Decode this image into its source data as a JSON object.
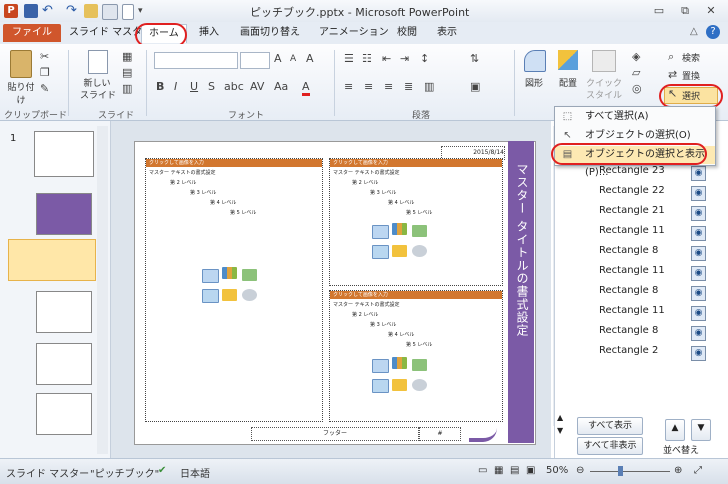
{
  "window": {
    "title": "ピッチブック.pptx - Microsoft PowerPoint"
  },
  "tabs": [
    {
      "label": "ファイル"
    },
    {
      "label": "スライド マスター"
    },
    {
      "label": "ホーム"
    },
    {
      "label": "挿入"
    },
    {
      "label": "画面切り替え"
    },
    {
      "label": "アニメーション"
    },
    {
      "label": "校閲"
    },
    {
      "label": "表示"
    }
  ],
  "ribbon": {
    "paste_label": "貼り付け",
    "new_slide_label": "新しい",
    "new_slide_label2": "スライド",
    "clipboard_group": "クリップボード",
    "slides_group": "スライド",
    "font_group": "フォント",
    "paragraph_group": "段落",
    "shape_label": "図形",
    "arrange_label": "配置",
    "quick_style_label": "クイック",
    "quick_style_label2": "スタイル",
    "find_label": "検索",
    "replace_label": "置換",
    "select_label": "選択"
  },
  "dropdown": {
    "items": [
      {
        "label": "すべて選択(A)"
      },
      {
        "label": "オブジェクトの選択(O)"
      },
      {
        "label": "オブジェクトの選択と表示(P)..."
      }
    ]
  },
  "slide": {
    "date": "2015/8/14",
    "placeholder_head": "クリックして画像を入力",
    "level1": "マスター テキストの書式設定",
    "level2": "第 2 レベル",
    "level3": "第 3 レベル",
    "level4": "第 4 レベル",
    "level5": "第 5 レベル",
    "footer": "フッター",
    "page_marker": "#",
    "vertical_title": "マスター タイトルの書式設定"
  },
  "thumbnails": {
    "first_number": "1"
  },
  "selection_pane": {
    "shapes": [
      {
        "name": "Rectangle 23"
      },
      {
        "name": "Rectangle 22"
      },
      {
        "name": "Rectangle 21"
      },
      {
        "name": "Rectangle 11"
      },
      {
        "name": "Rectangle 8"
      },
      {
        "name": "Rectangle 11"
      },
      {
        "name": "Rectangle 8"
      },
      {
        "name": "Rectangle 11"
      },
      {
        "name": "Rectangle 8"
      },
      {
        "name": "Rectangle 2"
      }
    ],
    "show_all": "すべて表示",
    "hide_all": "すべて非表示",
    "reorder": "並べ替え"
  },
  "status": {
    "view": "スライド マスター",
    "theme": "\"ピッチブック\"",
    "language": "日本語",
    "zoom": "50%"
  },
  "colors": {
    "file_tab": "#d0562c",
    "accent_purple": "#7b5aa6",
    "header_orange": "#d2772f",
    "annotation_red": "#e02020"
  }
}
